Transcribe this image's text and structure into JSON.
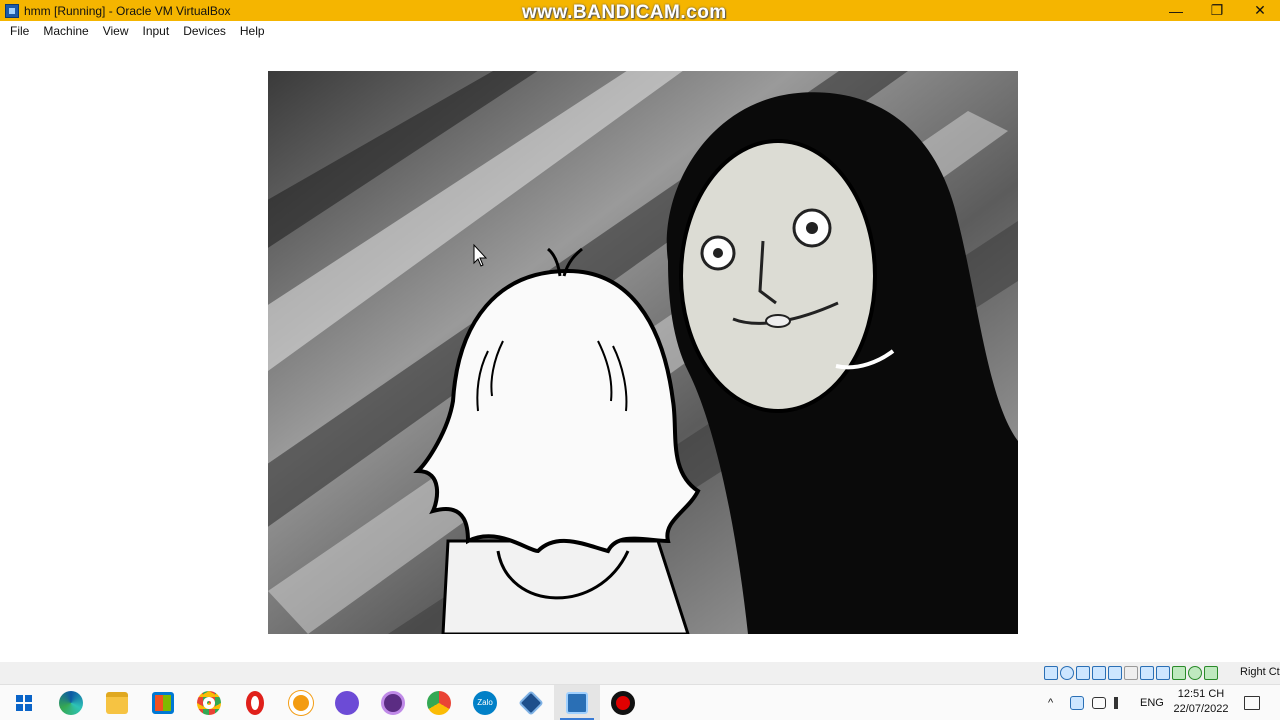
{
  "window": {
    "title": "hmm [Running] - Oracle VM VirtualBox",
    "watermark": "www.BANDICAM.com",
    "minimize": "—",
    "restore": "❐",
    "close": "✕"
  },
  "menu": {
    "items": [
      {
        "label": "File"
      },
      {
        "label": "Machine"
      },
      {
        "label": "View"
      },
      {
        "label": "Input"
      },
      {
        "label": "Devices"
      },
      {
        "label": "Help"
      }
    ]
  },
  "vm": {
    "content": "guest-display-cartoon",
    "cursor_icon": "mouse-pointer-icon"
  },
  "statusbar": {
    "icons": [
      "hard-disk-icon",
      "optical-drive-icon",
      "audio-icon",
      "network-icon",
      "usb-icon",
      "shared-folders-icon",
      "display-icon",
      "video-capture-icon",
      "recording-icon",
      "cpu-icon",
      "arrow-icon"
    ],
    "host_key": "Right Ctrl"
  },
  "taskbar": {
    "apps": [
      {
        "name": "start-button",
        "icon": "windows-logo-icon"
      },
      {
        "name": "edge",
        "icon": "edge-icon"
      },
      {
        "name": "file-explorer",
        "icon": "folder-icon"
      },
      {
        "name": "microsoft-store",
        "icon": "store-icon"
      },
      {
        "name": "chrome",
        "icon": "chrome-icon"
      },
      {
        "name": "opera",
        "icon": "opera-icon"
      },
      {
        "name": "app-orange",
        "icon": "orange-app-icon"
      },
      {
        "name": "app-purple",
        "icon": "purple-app-icon"
      },
      {
        "name": "app-purple-2",
        "icon": "purple-app-icon-2"
      },
      {
        "name": "chrome-profile",
        "icon": "chrome-profile-icon"
      },
      {
        "name": "zalo",
        "icon": "zalo-icon",
        "label": "Zalo"
      },
      {
        "name": "virtualbox",
        "icon": "virtualbox-icon"
      },
      {
        "name": "virtualbox-vm",
        "icon": "vm-window-icon"
      },
      {
        "name": "bandicam",
        "icon": "record-icon"
      }
    ],
    "tray": {
      "chevron": "^",
      "language": "ENG",
      "time": "12:51 CH",
      "date": "22/07/2022"
    }
  },
  "colors": {
    "titlebar": "#f5b500",
    "taskbar": "#fafafa"
  }
}
